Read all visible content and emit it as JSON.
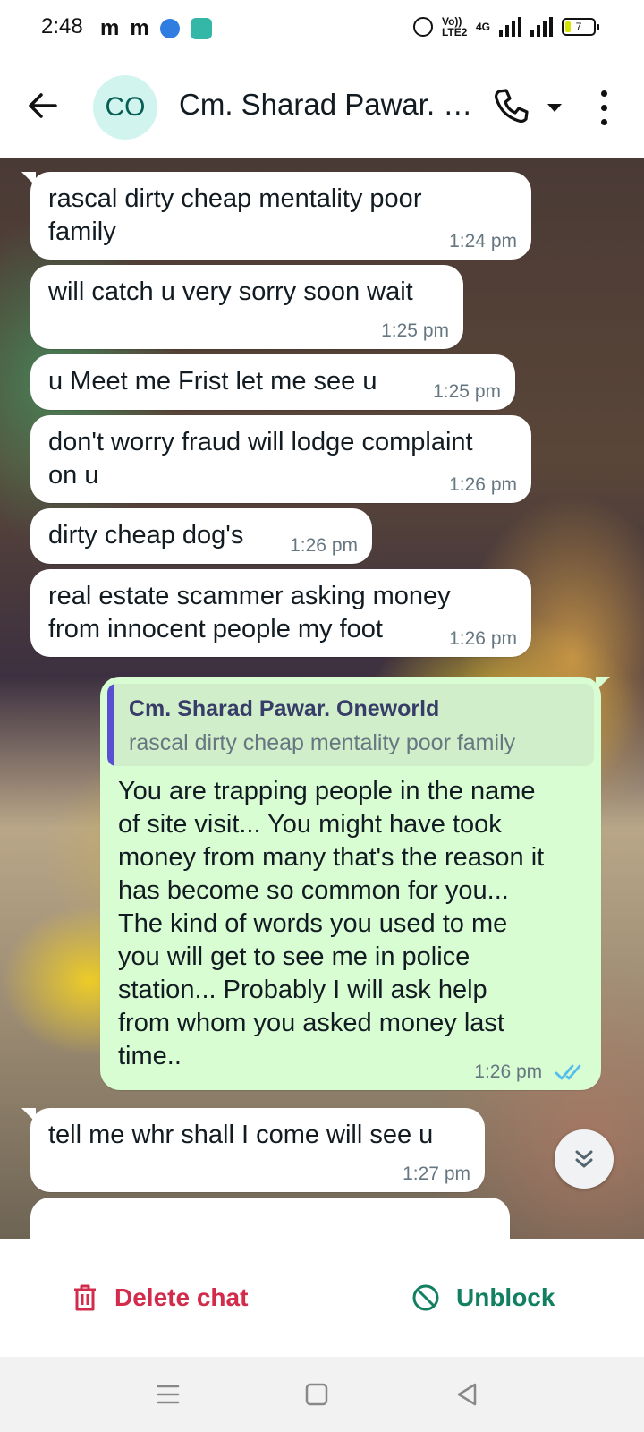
{
  "status_bar": {
    "time": "2:48",
    "left_icons": [
      "m",
      "m"
    ],
    "volte_label": "Vo)) LTE2",
    "network_label": "4G",
    "battery_level": "7"
  },
  "header": {
    "avatar_initials": "CO",
    "contact_name": "Cm. Sharad Pawar. Oneworld"
  },
  "messages": [
    {
      "direction": "in",
      "text": "rascal dirty cheap mentality poor\nfamily",
      "time": "1:24 pm"
    },
    {
      "direction": "in",
      "text": "will catch u very sorry soon wait",
      "time": "1:25 pm"
    },
    {
      "direction": "in",
      "text": "u Meet me Frist let me see u",
      "time": "1:25 pm"
    },
    {
      "direction": "in",
      "text": "don't worry fraud will lodge complaint\non u",
      "time": "1:26 pm"
    },
    {
      "direction": "in",
      "text": "dirty cheap dog's",
      "time": "1:26 pm"
    },
    {
      "direction": "in",
      "text": "real estate scammer asking money\nfrom innocent people my foot",
      "time": "1:26 pm"
    },
    {
      "direction": "out",
      "quote": {
        "author": "Cm. Sharad Pawar. Oneworld",
        "text": "rascal dirty cheap mentality poor family"
      },
      "text": "You are trapping people in the name\nof site visit... You might have took\nmoney from many that's the reason it\nhas become so common for you...\nThe kind of words you used to me\nyou will get to see me in police\nstation... Probably I will ask help\nfrom whom you asked money last\ntime..",
      "time": "1:26 pm",
      "status": "read"
    },
    {
      "direction": "in",
      "text": "tell me whr shall I come will see u",
      "time": "1:27 pm"
    }
  ],
  "actions": {
    "delete_label": "Delete chat",
    "unblock_label": "Unblock"
  },
  "colors": {
    "delete": "#d22b4b",
    "unblock": "#128060",
    "outgoing_bubble": "#d9fdd3",
    "read_ticks": "#53bdeb"
  },
  "icons": {
    "back": "arrow-left-icon",
    "call": "phone-icon",
    "dropdown": "caret-down-icon",
    "menu": "more-vertical-icon",
    "delete": "trash-icon",
    "unblock": "block-icon",
    "scroll_down": "double-chevron-down-icon"
  }
}
